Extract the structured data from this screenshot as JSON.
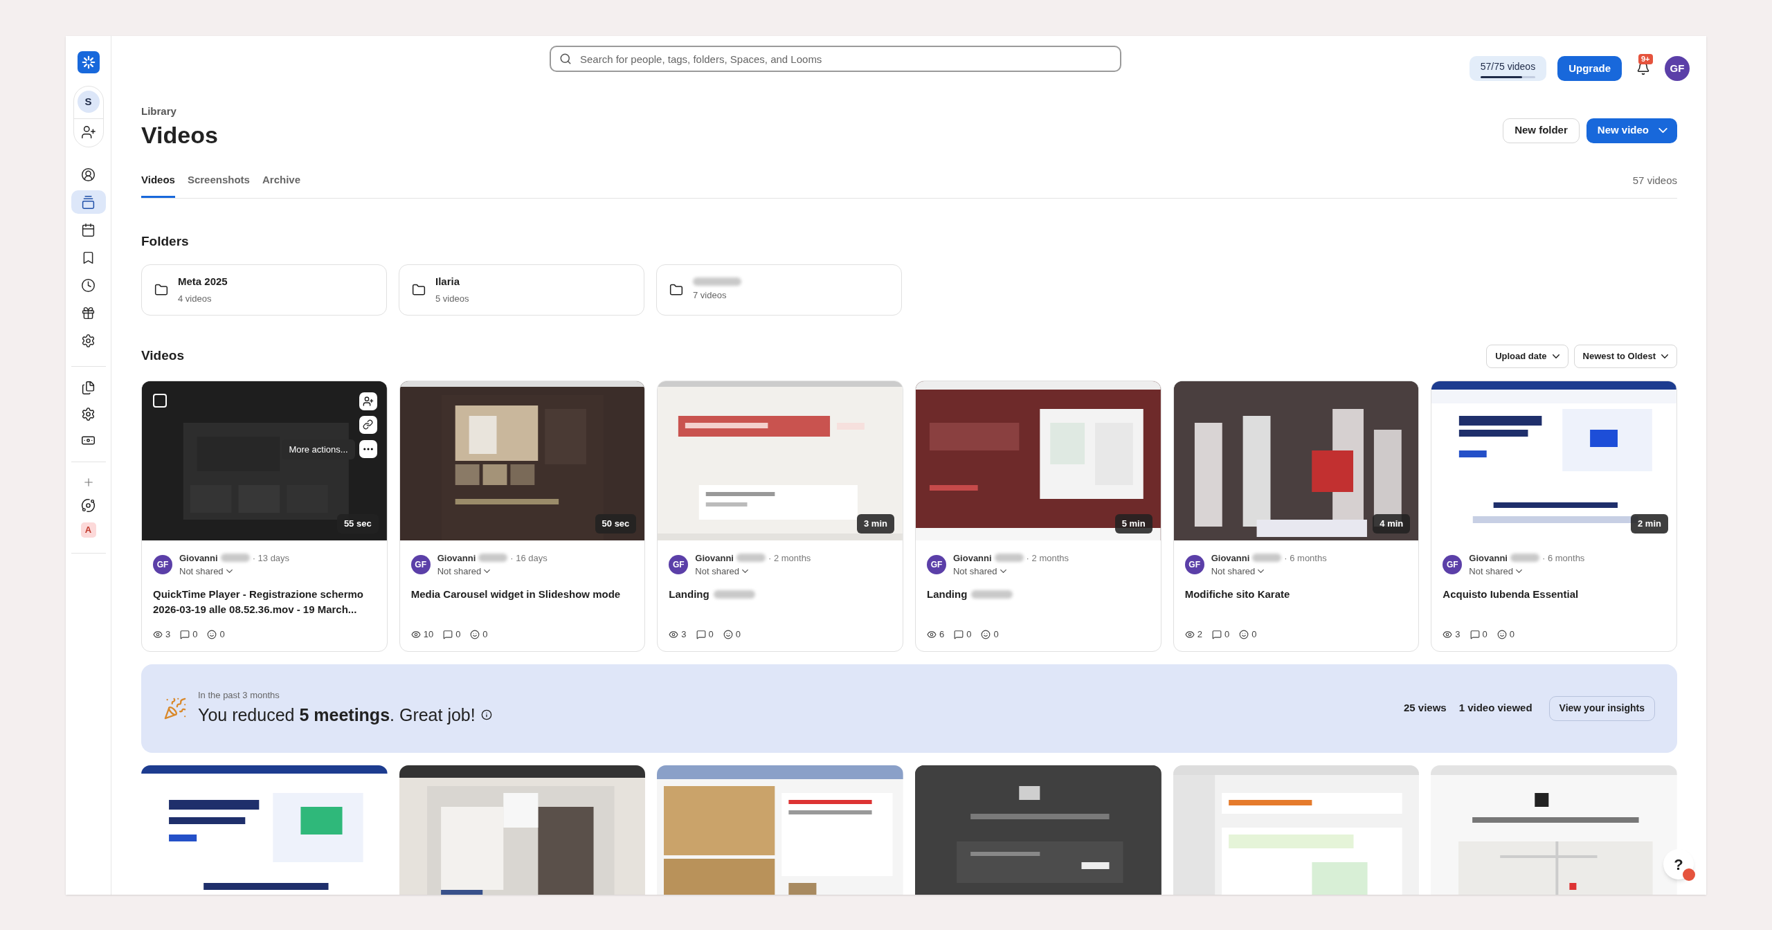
{
  "sidebar": {
    "workspace_initial": "S",
    "bottom_badge": "A",
    "items": [
      {
        "selected": false
      },
      {
        "selected": true
      },
      {
        "selected": false
      },
      {
        "selected": false
      },
      {
        "selected": false
      },
      {
        "selected": false
      },
      {
        "selected": false
      }
    ]
  },
  "topbar": {
    "search": {
      "placeholder": "Search for people, tags, folders, Spaces, and Looms"
    },
    "usage": {
      "label": "57/75 videos",
      "level": 0.76
    },
    "upgrade": "Upgrade",
    "notifications": "9+",
    "avatar": "GF"
  },
  "header": {
    "breadcrumb": "Library",
    "title": "Videos",
    "buttons": [
      "New folder",
      "New video"
    ]
  },
  "tabs": [
    {
      "label": "Videos",
      "selected": true
    },
    {
      "label": "Screenshots",
      "selected": false
    },
    {
      "label": "Archive",
      "selected": false
    }
  ],
  "video_count": "57 videos",
  "folders_heading": "Folders",
  "folders": [
    {
      "name": "Meta 2025",
      "count": "4 videos",
      "redacted": false
    },
    {
      "name": "Ilaria",
      "count": "5 videos",
      "redacted": false
    },
    {
      "count": "7 videos",
      "redacted": true
    }
  ],
  "videos_heading": "Videos",
  "sort": [
    "Upload date",
    "Newest to Oldest"
  ],
  "videos": [
    {
      "hovered": true,
      "checked": false,
      "tooltip": "More actions...",
      "duration": "55 sec",
      "avatar": "GF",
      "author": "Giovanni",
      "author_redacted": true,
      "age": "· 13 days",
      "sharing": "Not shared",
      "title": "QuickTime Player - Registrazione schermo 2026-03-19 alle 08.52.36.mov - 19 March...",
      "title_redacted": false,
      "views": "3",
      "comments": "0",
      "reactions": "0"
    },
    {
      "hovered": false,
      "duration": "50 sec",
      "avatar": "GF",
      "author": "Giovanni",
      "author_redacted": true,
      "age": "· 16 days",
      "sharing": "Not shared",
      "title": "Media Carousel widget in Slideshow mode",
      "title_redacted": false,
      "views": "10",
      "comments": "0",
      "reactions": "0"
    },
    {
      "hovered": false,
      "duration": "3 min",
      "avatar": "GF",
      "author": "Giovanni",
      "author_redacted": true,
      "age": "· 2 months",
      "sharing": "Not shared",
      "title": "Landing",
      "title_redacted": true,
      "views": "3",
      "comments": "0",
      "reactions": "0"
    },
    {
      "hovered": false,
      "duration": "5 min",
      "avatar": "GF",
      "author": "Giovanni",
      "author_redacted": true,
      "age": "· 2 months",
      "sharing": "Not shared",
      "title": "Landing",
      "title_redacted": true,
      "views": "6",
      "comments": "0",
      "reactions": "0"
    },
    {
      "hovered": false,
      "duration": "4 min",
      "avatar": "GF",
      "author": "Giovanni",
      "author_redacted": true,
      "age": "· 6 months",
      "sharing": "Not shared",
      "title": "Modifiche sito Karate",
      "title_redacted": false,
      "views": "2",
      "comments": "0",
      "reactions": "0"
    },
    {
      "hovered": false,
      "duration": "2 min",
      "avatar": "GF",
      "author": "Giovanni",
      "author_redacted": true,
      "age": "· 6 months",
      "sharing": "Not shared",
      "title": "Acquisto Iubenda Essential",
      "title_redacted": false,
      "views": "3",
      "comments": "0",
      "reactions": "0"
    }
  ],
  "banner": {
    "caption": "In the past 3 months",
    "message": "You reduced **5 meetings**. Great job!",
    "stats": [
      "25 views",
      "1 video viewed"
    ],
    "button": "View your insights"
  },
  "more_videos": [
    {
      "kind": "picture"
    },
    {
      "kind": "picture"
    },
    {
      "kind": "picture"
    },
    {
      "kind": "picture"
    },
    {
      "kind": "picture"
    },
    {
      "kind": "picture"
    }
  ],
  "help": "?"
}
